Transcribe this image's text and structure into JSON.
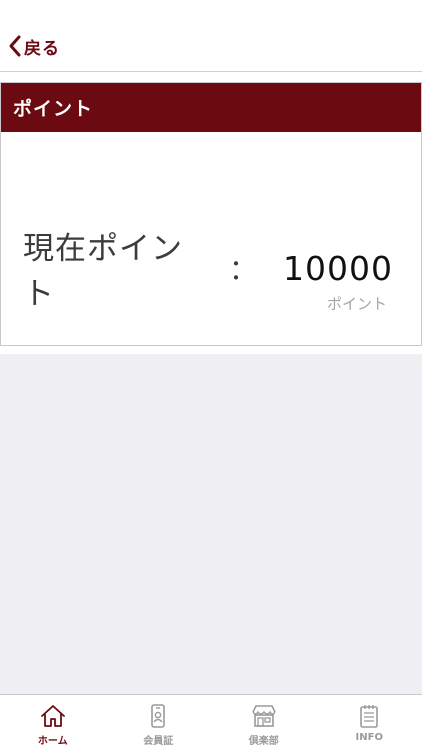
{
  "nav": {
    "back_label": "戻る"
  },
  "card": {
    "title": "ポイント",
    "current_points_label": "現在ポイント",
    "separator": "：",
    "current_points_value": "10000",
    "unit": "ポイント"
  },
  "tabs": [
    {
      "label": "ホーム",
      "icon": "home-icon",
      "active": true
    },
    {
      "label": "会員証",
      "icon": "member-card-icon",
      "active": false
    },
    {
      "label": "倶楽部",
      "icon": "store-icon",
      "active": false
    },
    {
      "label": "INFO",
      "icon": "notepad-icon",
      "active": false
    }
  ],
  "colors": {
    "brand": "#6c0a12",
    "inactive_tab": "#9a9a9a",
    "background": "#efeff4"
  }
}
